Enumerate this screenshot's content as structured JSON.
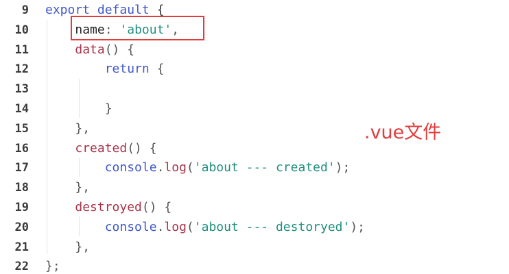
{
  "editor": {
    "lines": [
      {
        "num": "9",
        "tokens": [
          [
            "kw-blue",
            "export"
          ],
          [
            "kw-plain",
            " "
          ],
          [
            "kw-blue",
            "default"
          ],
          [
            "kw-plain",
            " {"
          ]
        ]
      },
      {
        "num": "10",
        "tokens": [
          [
            "kw-plain",
            "    "
          ],
          [
            "kw-dark",
            "name"
          ],
          [
            "punct",
            ": "
          ],
          [
            "str",
            "'about'"
          ],
          [
            "punct",
            ","
          ]
        ]
      },
      {
        "num": "11",
        "tokens": [
          [
            "kw-plain",
            "    "
          ],
          [
            "kw-red",
            "data"
          ],
          [
            "punct",
            "() {"
          ]
        ]
      },
      {
        "num": "12",
        "tokens": [
          [
            "kw-plain",
            "        "
          ],
          [
            "kw-blue",
            "return"
          ],
          [
            "punct",
            " {"
          ]
        ]
      },
      {
        "num": "13",
        "tokens": [
          [
            "kw-plain",
            ""
          ]
        ]
      },
      {
        "num": "14",
        "tokens": [
          [
            "kw-plain",
            "        "
          ],
          [
            "punct",
            "}"
          ]
        ]
      },
      {
        "num": "15",
        "tokens": [
          [
            "kw-plain",
            "    "
          ],
          [
            "punct",
            "},"
          ]
        ]
      },
      {
        "num": "16",
        "tokens": [
          [
            "kw-plain",
            "    "
          ],
          [
            "kw-red",
            "created"
          ],
          [
            "punct",
            "() {"
          ]
        ]
      },
      {
        "num": "17",
        "tokens": [
          [
            "kw-plain",
            "        "
          ],
          [
            "kw-blue",
            "console"
          ],
          [
            "punct",
            "."
          ],
          [
            "kw-red",
            "log"
          ],
          [
            "punct",
            "("
          ],
          [
            "str",
            "'about --- created'"
          ],
          [
            "punct",
            ");"
          ]
        ]
      },
      {
        "num": "18",
        "tokens": [
          [
            "kw-plain",
            "    "
          ],
          [
            "punct",
            "},"
          ]
        ]
      },
      {
        "num": "19",
        "tokens": [
          [
            "kw-plain",
            "    "
          ],
          [
            "kw-red",
            "destroyed"
          ],
          [
            "punct",
            "() {"
          ]
        ]
      },
      {
        "num": "20",
        "tokens": [
          [
            "kw-plain",
            "        "
          ],
          [
            "kw-blue",
            "console"
          ],
          [
            "punct",
            "."
          ],
          [
            "kw-red",
            "log"
          ],
          [
            "punct",
            "("
          ],
          [
            "str",
            "'about --- destoryed'"
          ],
          [
            "punct",
            ");"
          ]
        ]
      },
      {
        "num": "21",
        "tokens": [
          [
            "kw-plain",
            "    "
          ],
          [
            "punct",
            "},"
          ]
        ]
      },
      {
        "num": "22",
        "tokens": [
          [
            "punct",
            "};"
          ]
        ]
      }
    ]
  },
  "annotation": {
    "text": ".vue文件",
    "color": "#e23b3b"
  },
  "colors": {
    "keyword": "#3f57c9",
    "function": "#a8334a",
    "string": "#1f8f7f",
    "highlight_border": "#e23b3b"
  }
}
